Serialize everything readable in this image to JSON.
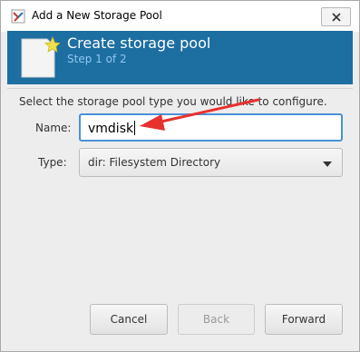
{
  "window": {
    "title": "Add a New Storage Pool",
    "close_icon": "close-icon"
  },
  "header": {
    "title": "Create storage pool",
    "step": "Step 1 of 2",
    "icon": "new-document-icon",
    "bg_color": "#1d6ea1"
  },
  "form": {
    "instruction": "Select the storage pool type you would like to configure.",
    "name_label": "Name:",
    "name_value": "vmdisk",
    "type_label": "Type:",
    "type_value": "dir: Filesystem Directory"
  },
  "buttons": {
    "cancel": "Cancel",
    "back": "Back",
    "forward": "Forward"
  },
  "annotation": {
    "arrow_color": "#e8312f"
  }
}
